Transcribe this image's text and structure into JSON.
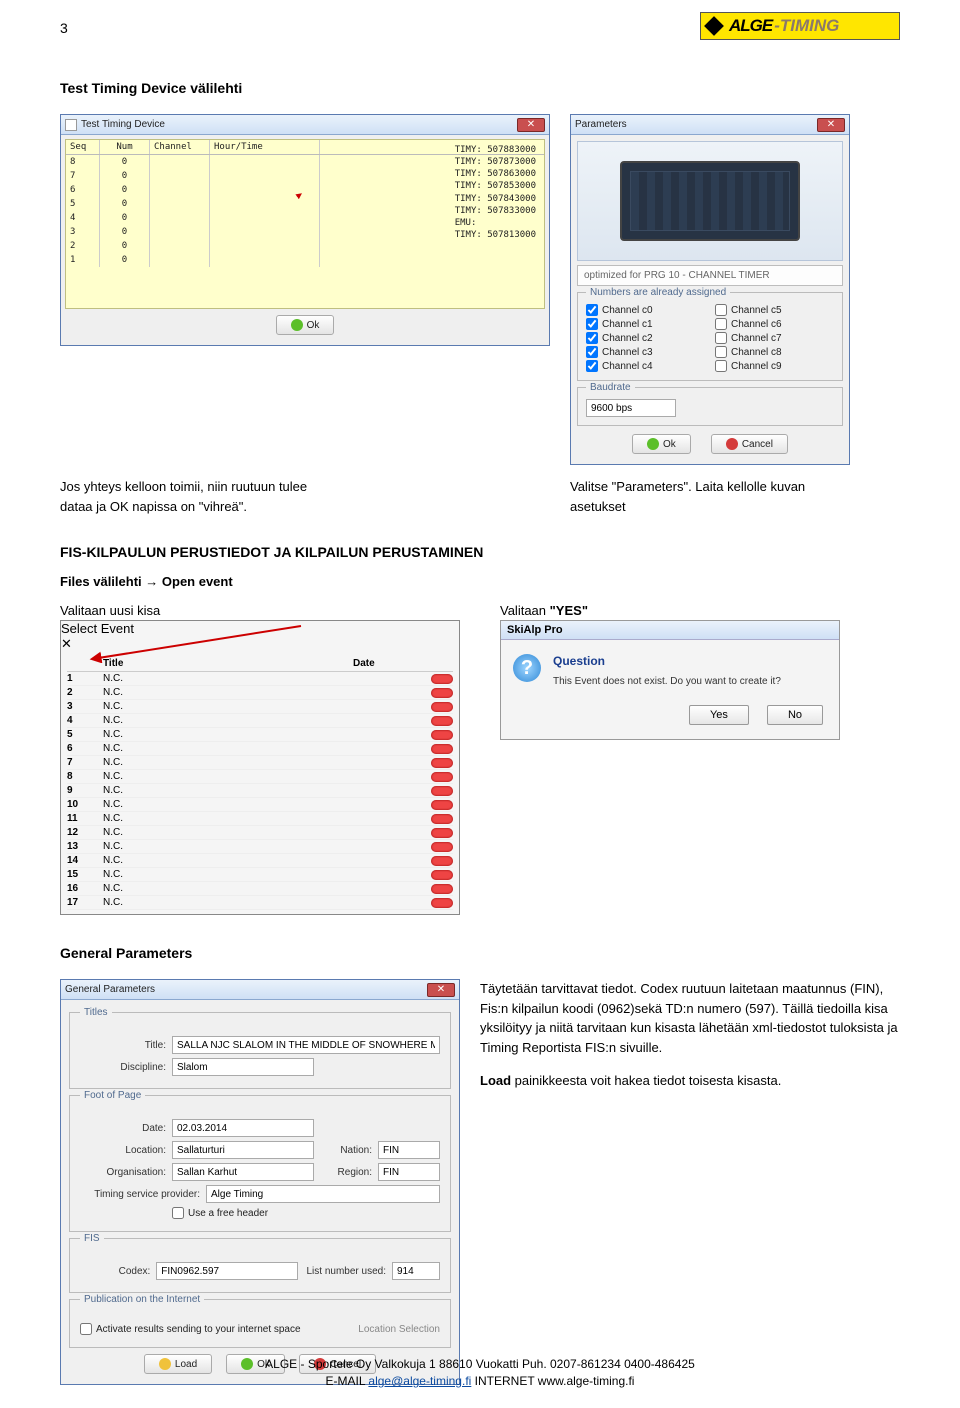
{
  "page": {
    "num": "3"
  },
  "logo": {
    "brand1": "ALGE",
    "brand2": "-TIMING"
  },
  "sect1": {
    "heading": "Test Timing Device välilehti",
    "caption_left_l1": "Jos yhteys kelloon toimii, niin ruutuun tulee",
    "caption_left_l2": "dataa ja OK napissa on \"vihreä\".",
    "caption_right_l1": "Valitse \"Parameters\". Laita kellolle kuvan",
    "caption_right_l2": "asetukset"
  },
  "ttd": {
    "title": "Test Timing Device",
    "headers": {
      "seq": "Seq",
      "num": "Num",
      "channel": "Channel",
      "ht": "Hour/Time"
    },
    "rows": [
      {
        "seq": "8",
        "num": "0"
      },
      {
        "seq": "7",
        "num": "0"
      },
      {
        "seq": "6",
        "num": "0"
      },
      {
        "seq": "5",
        "num": "0"
      },
      {
        "seq": "4",
        "num": "0"
      },
      {
        "seq": "3",
        "num": "0"
      },
      {
        "seq": "2",
        "num": "0"
      },
      {
        "seq": "1",
        "num": "0"
      }
    ],
    "datalines": [
      "TIMY:  507883000",
      "TIMY:  507873000",
      "TIMY:  507863000",
      "TIMY:  507853000",
      "TIMY:  507843000",
      "TIMY:  507833000",
      "EMU:",
      "TIMY:  507813000"
    ],
    "ok": "Ok"
  },
  "params": {
    "title": "Parameters",
    "optimized": "optimized for PRG 10 - CHANNEL TIMER",
    "numbers_legend": "Numbers are already assigned",
    "channels": [
      {
        "l": "Channel c0",
        "c": true
      },
      {
        "l": "Channel c5",
        "c": false
      },
      {
        "l": "Channel c1",
        "c": true
      },
      {
        "l": "Channel c6",
        "c": false
      },
      {
        "l": "Channel c2",
        "c": true
      },
      {
        "l": "Channel c7",
        "c": false
      },
      {
        "l": "Channel c3",
        "c": true
      },
      {
        "l": "Channel c8",
        "c": false
      },
      {
        "l": "Channel c4",
        "c": true
      },
      {
        "l": "Channel c9",
        "c": false
      }
    ],
    "baud_legend": "Baudrate",
    "baud_value": "9600 bps",
    "ok": "Ok",
    "cancel": "Cancel"
  },
  "sect2": {
    "heading": "FIS-KILPAULUN PERUSTIEDOT JA KILPAILUN PERUSTAMINEN",
    "sub_l1a": "Files välilehti ",
    "sub_l1b": " Open event",
    "left_caption": "Valitaan uusi kisa",
    "right_caption": "Valitaan ",
    "right_caption_b": "\"YES\""
  },
  "selectEvent": {
    "title": "Select Event",
    "h1": "",
    "h2": "Title",
    "h3": "Date",
    "rows": [
      {
        "n": "1",
        "t": "N.C."
      },
      {
        "n": "2",
        "t": "N.C."
      },
      {
        "n": "3",
        "t": "N.C."
      },
      {
        "n": "4",
        "t": "N.C."
      },
      {
        "n": "5",
        "t": "N.C."
      },
      {
        "n": "6",
        "t": "N.C."
      },
      {
        "n": "7",
        "t": "N.C."
      },
      {
        "n": "8",
        "t": "N.C."
      },
      {
        "n": "9",
        "t": "N.C."
      },
      {
        "n": "10",
        "t": "N.C."
      },
      {
        "n": "11",
        "t": "N.C."
      },
      {
        "n": "12",
        "t": "N.C."
      },
      {
        "n": "13",
        "t": "N.C."
      },
      {
        "n": "14",
        "t": "N.C."
      },
      {
        "n": "15",
        "t": "N.C."
      },
      {
        "n": "16",
        "t": "N.C."
      },
      {
        "n": "17",
        "t": "N.C."
      }
    ]
  },
  "msg": {
    "app": "SkiAlp Pro",
    "q": "Question",
    "text": "This Event does not exist. Do you want to create it?",
    "yes": "Yes",
    "no": "No"
  },
  "sect3": {
    "heading": "General Parameters"
  },
  "gp": {
    "title": "General Parameters",
    "titles_legend": "Titles",
    "title_label": "Title:",
    "title_value": "SALLA NJC SLALOM IN THE MIDDLE OF SNOWHERE MEN",
    "disc_label": "Discipline:",
    "disc_value": "Slalom",
    "foot_legend": "Foot of Page",
    "date_label": "Date:",
    "date_value": "02.03.2014",
    "loc_label": "Location:",
    "loc_value": "Sallaturturi",
    "nation_label": "Nation:",
    "nation_value": "FIN",
    "org_label": "Organisation:",
    "org_value": "Sallan Karhut",
    "region_label": "Region:",
    "region_value": "FIN",
    "tsp_label": "Timing service provider:",
    "tsp_value": "Alge Timing",
    "freeheader_label": "Use a free header",
    "fis_legend": "FIS",
    "codex_label": "Codex:",
    "codex_value": "FIN0962.597",
    "list_label": "List number used:",
    "list_value": "914",
    "pub_legend": "Publication on the Internet",
    "pub_chk": "Activate results sending to your internet space",
    "loc_sel": "Location Selection",
    "load": "Load",
    "ok": "Ok",
    "cancel": "Cancel"
  },
  "gpText": {
    "p1": "Täytetään tarvittavat tiedot. Codex ruutuun laitetaan maatunnus (FIN), Fis:n kilpailun koodi (0962)sekä TD:n numero (597). Täillä tiedoilla kisa yksilöityy ja niitä tarvitaan kun kisasta lähetään xml-tiedostot tuloksista ja Timing Reportista FIS:n sivuille.",
    "p2a": "Load",
    "p2b": " painikkeesta voit hakea tiedot toisesta kisasta."
  },
  "footer": {
    "l1": "ALGE - Sportele Oy Valkokuja 1 88610 Vuokatti  Puh. 0207-861234  0400-486425",
    "l2a": "E-MAIL ",
    "email": "alge@alge-timing.fi",
    "l2b": "  INTERNET www.alge-timing.fi"
  }
}
